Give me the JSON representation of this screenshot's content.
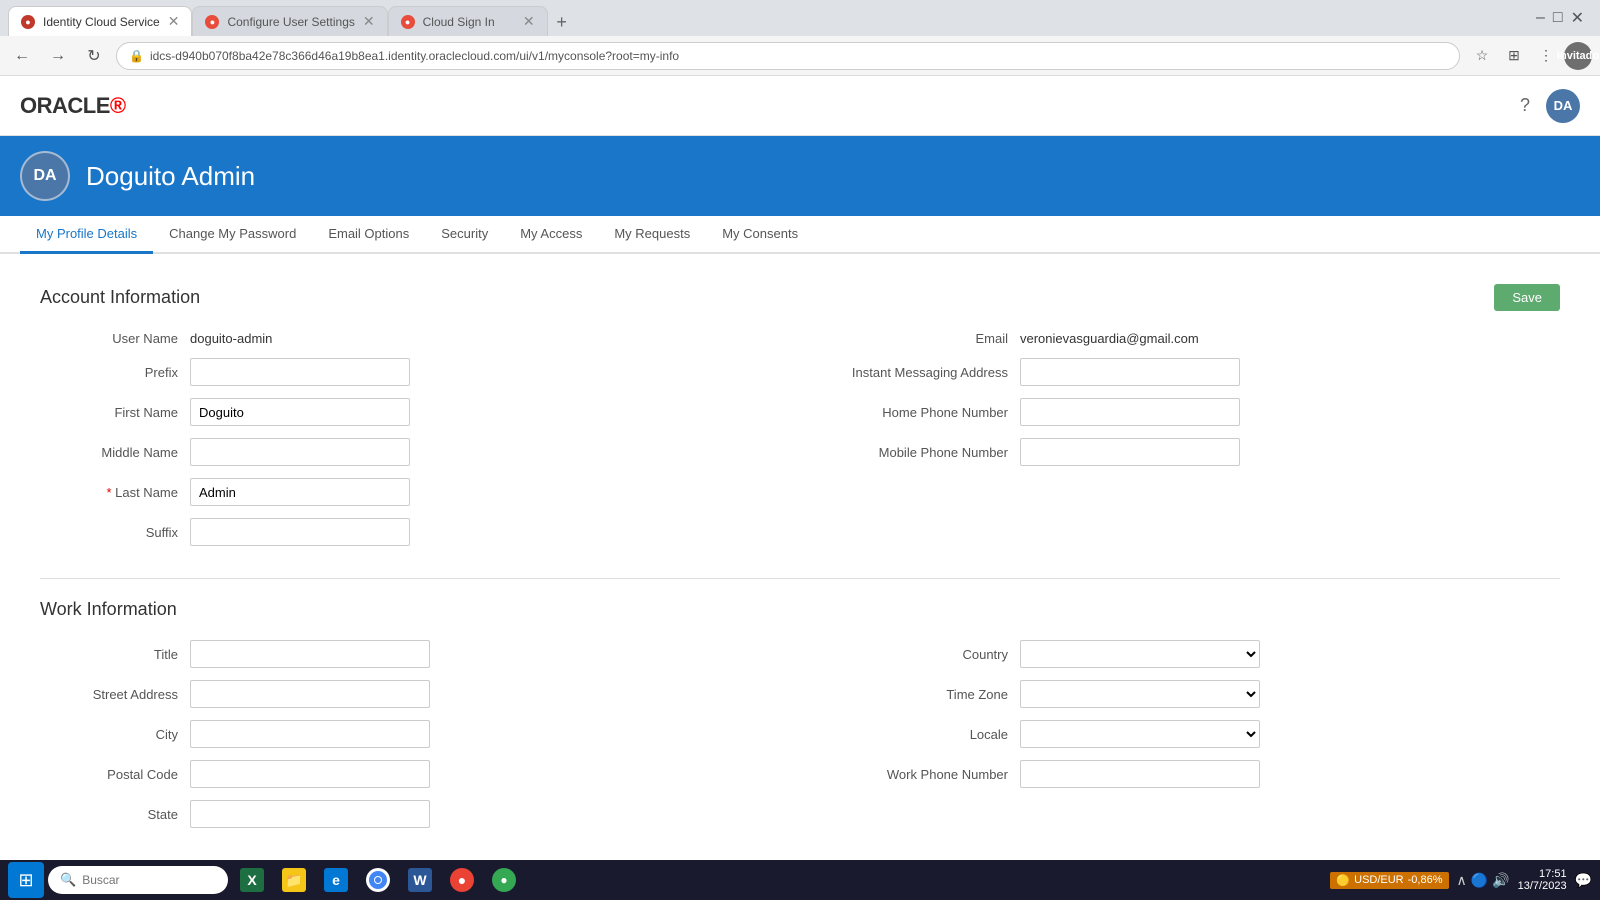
{
  "browser": {
    "tabs": [
      {
        "id": "tab1",
        "label": "Identity Cloud Service",
        "active": true,
        "favicon_type": "oracle"
      },
      {
        "id": "tab2",
        "label": "Configure User Settings",
        "active": false,
        "favicon_type": "config"
      },
      {
        "id": "tab3",
        "label": "Cloud Sign In",
        "active": false,
        "favicon_type": "cloud"
      }
    ],
    "address": "idcs-d940b070f8ba42e78c366d46a19b8ea1.identity.oraclecloud.com/ui/v1/myconsole?root=my-info",
    "profile_label": "Invitado"
  },
  "header": {
    "logo": "ORACLE",
    "help_icon": "?",
    "user_initials": "DA"
  },
  "banner": {
    "user_initials": "DA",
    "user_name": "Doguito Admin"
  },
  "tabs": [
    {
      "id": "my-profile",
      "label": "My Profile Details",
      "active": true
    },
    {
      "id": "change-password",
      "label": "Change My Password",
      "active": false
    },
    {
      "id": "email-options",
      "label": "Email Options",
      "active": false
    },
    {
      "id": "security",
      "label": "Security",
      "active": false
    },
    {
      "id": "my-access",
      "label": "My Access",
      "active": false
    },
    {
      "id": "my-requests",
      "label": "My Requests",
      "active": false
    },
    {
      "id": "my-consents",
      "label": "My Consents",
      "active": false
    }
  ],
  "sections": {
    "account_info": {
      "title": "Account Information",
      "save_label": "Save",
      "fields_left": [
        {
          "label": "User Name",
          "type": "static",
          "value": "doguito-admin",
          "required": false
        },
        {
          "label": "Prefix",
          "type": "input",
          "value": "",
          "required": false
        },
        {
          "label": "First Name",
          "type": "input",
          "value": "Doguito",
          "required": false
        },
        {
          "label": "Middle Name",
          "type": "input",
          "value": "",
          "required": false
        },
        {
          "label": "Last Name",
          "type": "input",
          "value": "Admin",
          "required": true
        },
        {
          "label": "Suffix",
          "type": "input",
          "value": "",
          "required": false
        }
      ],
      "fields_right": [
        {
          "label": "Email",
          "type": "static",
          "value": "veronievasguardia@gmail.com",
          "required": false
        },
        {
          "label": "Instant Messaging Address",
          "type": "input",
          "value": "",
          "required": false
        },
        {
          "label": "Home Phone Number",
          "type": "input",
          "value": "",
          "required": false
        },
        {
          "label": "Mobile Phone Number",
          "type": "input",
          "value": "",
          "required": false
        }
      ]
    },
    "work_info": {
      "title": "Work Information",
      "fields_left": [
        {
          "label": "Title",
          "type": "input",
          "value": "",
          "required": false
        },
        {
          "label": "Street Address",
          "type": "input",
          "value": "",
          "required": false
        },
        {
          "label": "City",
          "type": "input",
          "value": "",
          "required": false
        },
        {
          "label": "Postal Code",
          "type": "input",
          "value": "",
          "required": false
        },
        {
          "label": "State",
          "type": "input",
          "value": "",
          "required": false
        }
      ],
      "fields_right": [
        {
          "label": "Country",
          "type": "select",
          "value": "",
          "required": false
        },
        {
          "label": "Time Zone",
          "type": "select",
          "value": "",
          "required": false
        },
        {
          "label": "Locale",
          "type": "select",
          "value": "",
          "required": false
        },
        {
          "label": "Work Phone Number",
          "type": "input",
          "value": "",
          "required": false
        }
      ]
    }
  },
  "taskbar": {
    "search_placeholder": "Buscar",
    "time": "17:51",
    "date": "13/7/2023",
    "currency": "USD/EUR",
    "currency_change": "-0,86%"
  }
}
